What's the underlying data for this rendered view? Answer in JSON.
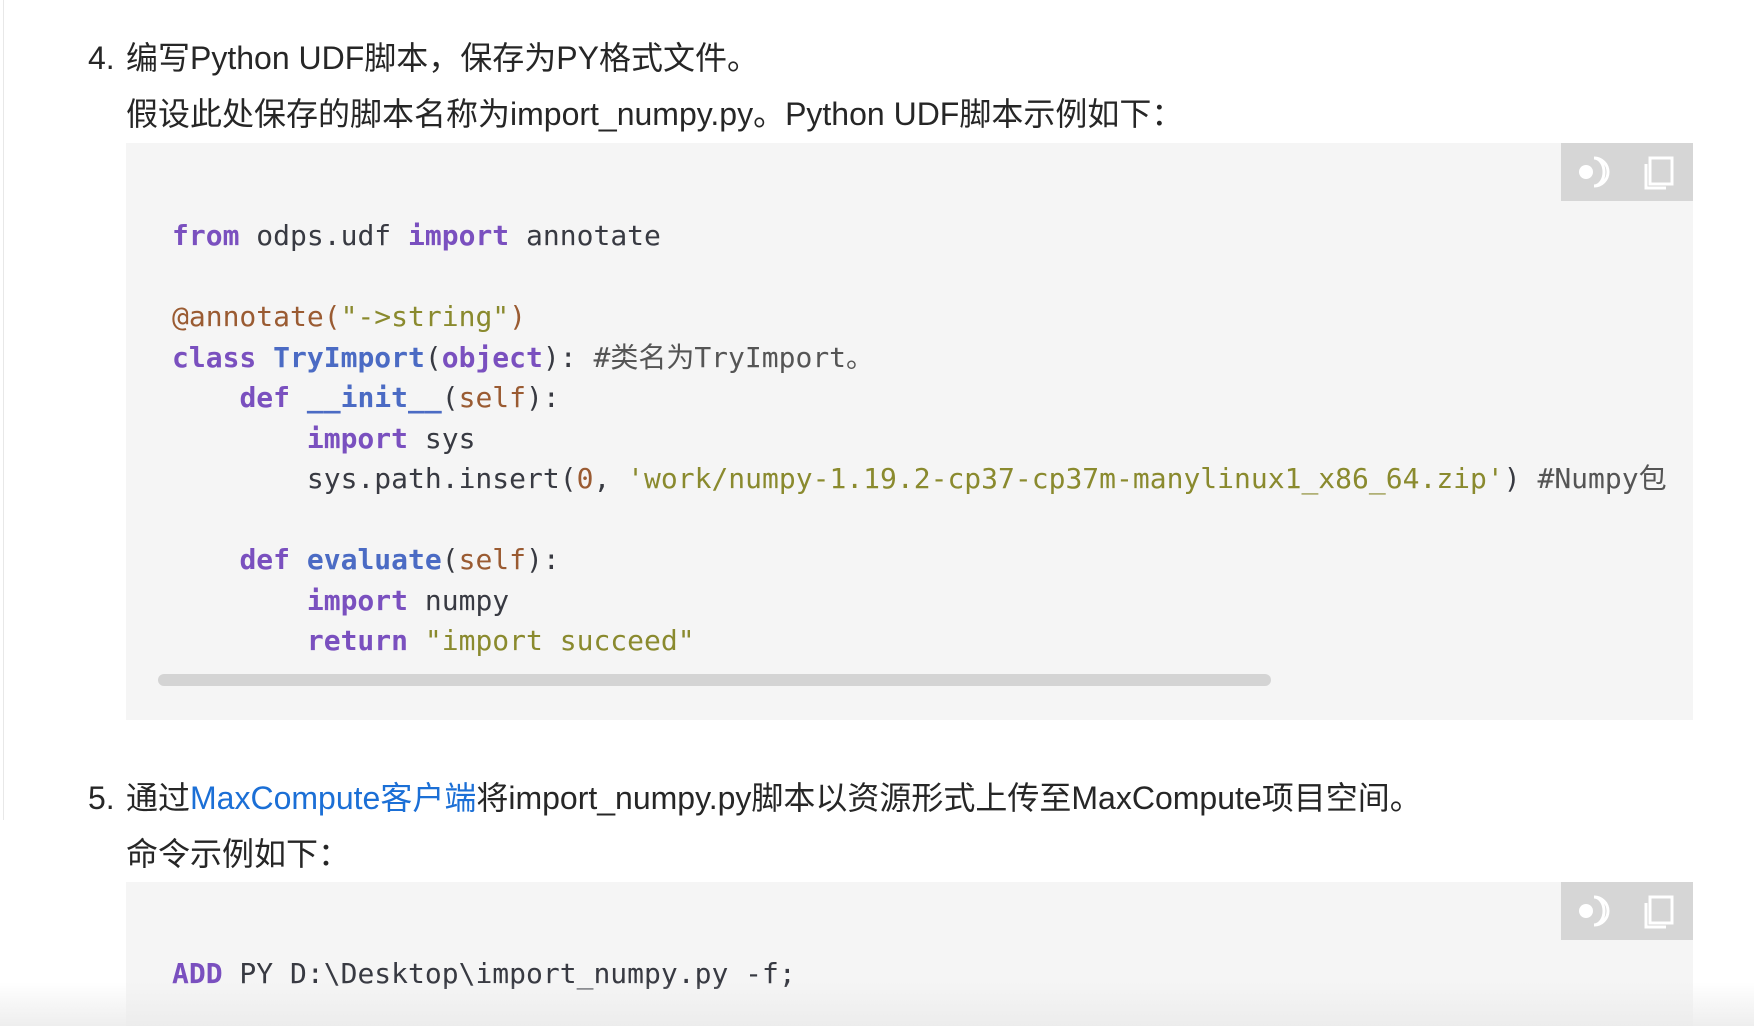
{
  "step4": {
    "number": "4.",
    "title": "编写Python UDF脚本，保存为PY格式文件。",
    "subtitle": "假设此处保存的脚本名称为import_numpy.py。Python UDF脚本示例如下："
  },
  "code1": {
    "lines": [
      "from odps.udf import annotate",
      "",
      "@annotate(\"->string\")",
      "class TryImport(object): #类名为TryImport。",
      "    def __init__(self):",
      "        import sys",
      "        sys.path.insert(0, 'work/numpy-1.19.2-cp37-cp37m-manylinux1_x86_64.zip') #Numpy包",
      "",
      "    def evaluate(self):",
      "        import numpy",
      "        return \"import succeed\""
    ]
  },
  "step5": {
    "number": "5.",
    "title_before": "通过",
    "title_link": "MaxCompute客户端",
    "title_after": "将import_numpy.py脚本以资源形式上传至MaxCompute项目空间。",
    "subtitle": "命令示例如下："
  },
  "code2": {
    "lines": [
      "ADD PY D:\\Desktop\\import_numpy.py -f;"
    ]
  },
  "icons": {
    "theme_toggle": "theme-toggle-icon",
    "copy": "copy-icon"
  },
  "colors": {
    "keyword": "#7a50bf",
    "function": "#4b6bc4",
    "string": "#8a8a2e",
    "link": "#1b6fd6",
    "code_bg": "#f5f5f5"
  }
}
